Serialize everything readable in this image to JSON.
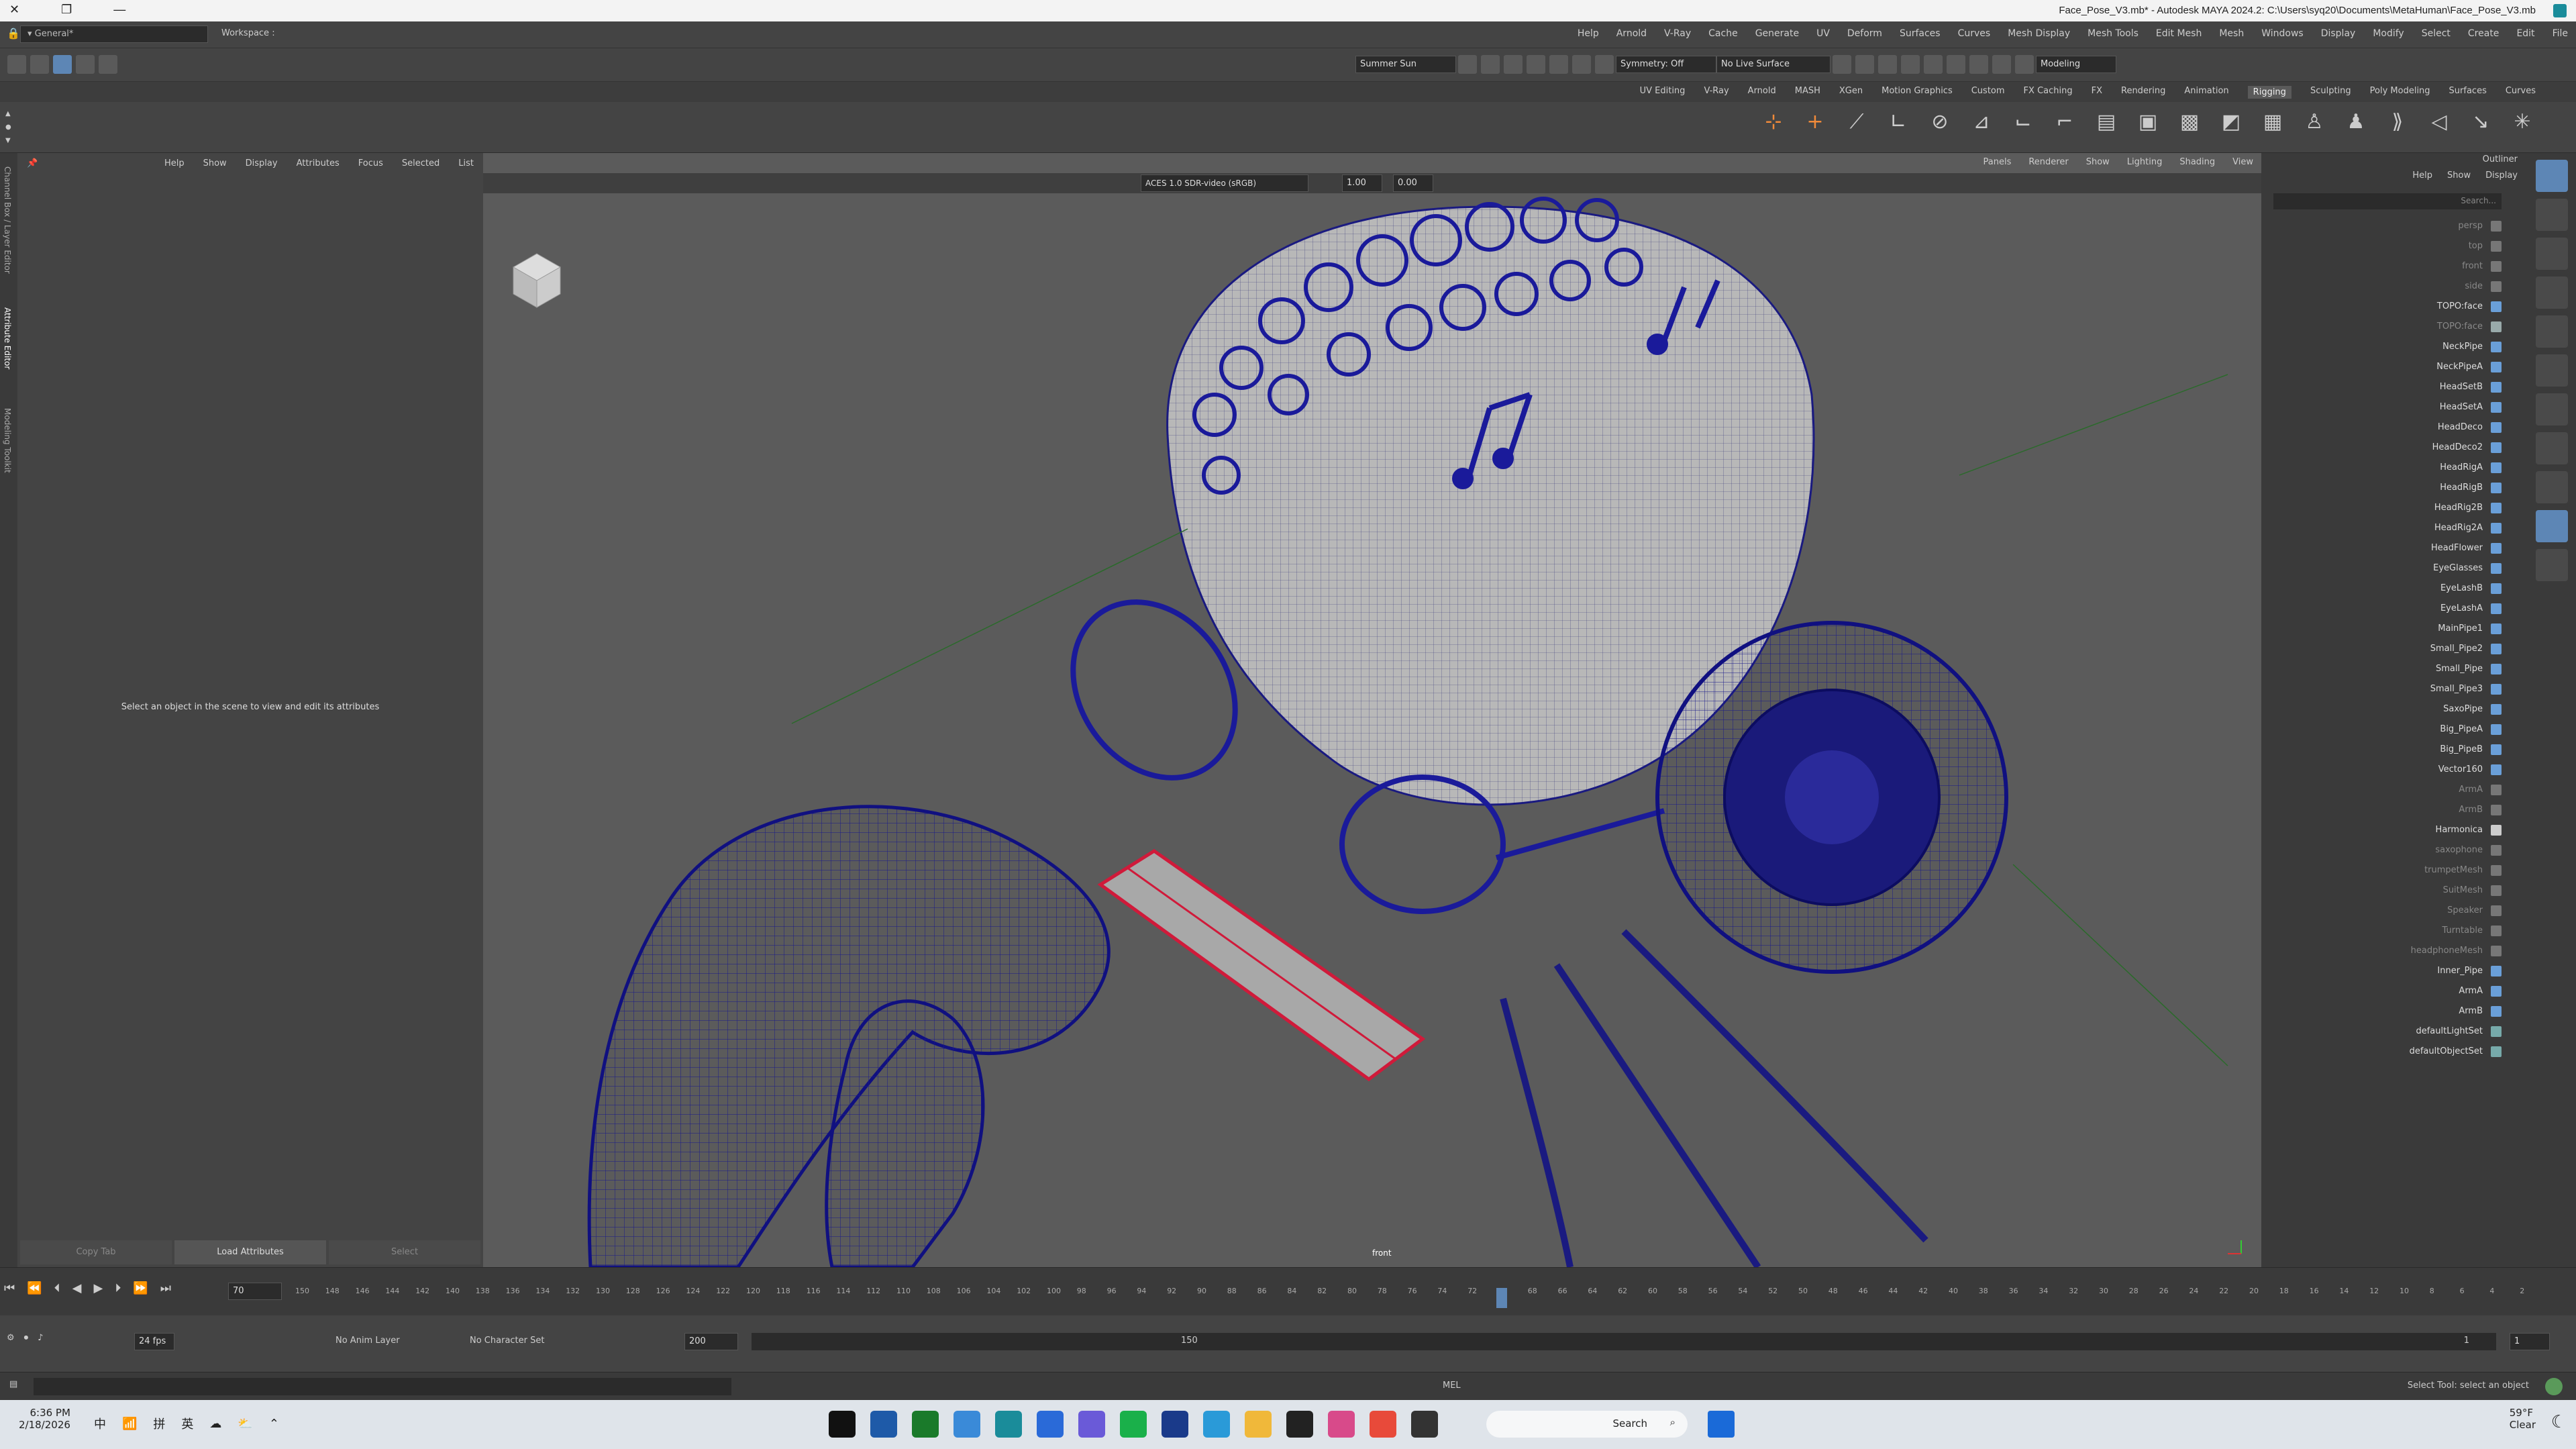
{
  "titlebar": {
    "title": "Face_Pose_V3.mb* - Autodesk MAYA 2024.2: C:\\Users\\syq20\\Documents\\MetaHuman\\Face_Pose_V3.mb",
    "app_icon": "maya-icon"
  },
  "menubar": {
    "workspace_label": "Workspace :",
    "workspace_value": "General*",
    "menus": [
      "File",
      "Edit",
      "Create",
      "Select",
      "Modify",
      "Display",
      "Windows",
      "Mesh",
      "Edit Mesh",
      "Mesh Tools",
      "Mesh Display",
      "Curves",
      "Surfaces",
      "Deform",
      "UV",
      "Generate",
      "Cache",
      "V-Ray",
      "Arnold",
      "Help"
    ]
  },
  "statusline": {
    "mode": "Modeling",
    "symmetry": "Symmetry: Off",
    "live": "No Live Surface",
    "sun": "Summer Sun"
  },
  "shelf": {
    "tabs": [
      "Curves",
      "Surfaces",
      "Poly Modeling",
      "Sculpting",
      "Rigging",
      "Animation",
      "Rendering",
      "FX",
      "FX Caching",
      "Custom",
      "Motion Graphics",
      "XGen",
      "MASH",
      "Arnold",
      "V-Ray"
    ],
    "active_tab": "Rigging",
    "uv_editing": "UV Editing"
  },
  "left_strip": {
    "tabs": [
      "Channel Box / Layer Editor",
      "Attribute Editor",
      "Modeling Toolkit"
    ]
  },
  "attribute_editor": {
    "menus": [
      "List",
      "Selected",
      "Focus",
      "Attributes",
      "Display",
      "Show",
      "Help"
    ],
    "message": "Select an object in the scene to view and edit its attributes",
    "buttons": {
      "select": "Select",
      "load": "Load Attributes",
      "copy": "Copy Tab"
    }
  },
  "viewport": {
    "menus": [
      "View",
      "Shading",
      "Lighting",
      "Show",
      "Renderer",
      "Panels"
    ],
    "exposure": "0.00",
    "gamma": "1.00",
    "colorspace": "ACES 1.0 SDR-video (sRGB)",
    "camera": "front"
  },
  "outliner": {
    "title": "Outliner",
    "menus": [
      "Display",
      "Show",
      "Help"
    ],
    "search_placeholder": "Search...",
    "items": [
      {
        "label": "persp",
        "dim": true,
        "color": "#777"
      },
      {
        "label": "top",
        "dim": true,
        "color": "#777"
      },
      {
        "label": "front",
        "dim": true,
        "color": "#777"
      },
      {
        "label": "side",
        "dim": true,
        "color": "#777"
      },
      {
        "label": "TOPO:face",
        "dim": false,
        "color": "#6a9fd8"
      },
      {
        "label": "TOPO:face",
        "dim": true,
        "color": "#9aa"
      },
      {
        "label": "NeckPipe",
        "dim": false,
        "color": "#6a9fd8"
      },
      {
        "label": "NeckPipeA",
        "dim": false,
        "color": "#6a9fd8"
      },
      {
        "label": "HeadSetB",
        "dim": false,
        "color": "#6a9fd8"
      },
      {
        "label": "HeadSetA",
        "dim": false,
        "color": "#6a9fd8"
      },
      {
        "label": "HeadDeco",
        "dim": false,
        "color": "#6a9fd8"
      },
      {
        "label": "HeadDeco2",
        "dim": false,
        "color": "#6a9fd8"
      },
      {
        "label": "HeadRigA",
        "dim": false,
        "color": "#6a9fd8"
      },
      {
        "label": "HeadRigB",
        "dim": false,
        "color": "#6a9fd8"
      },
      {
        "label": "HeadRig2B",
        "dim": false,
        "color": "#6a9fd8"
      },
      {
        "label": "HeadRig2A",
        "dim": false,
        "color": "#6a9fd8"
      },
      {
        "label": "HeadFlower",
        "dim": false,
        "color": "#6a9fd8"
      },
      {
        "label": "EyeGlasses",
        "dim": false,
        "color": "#6a9fd8"
      },
      {
        "label": "EyeLashB",
        "dim": false,
        "color": "#6a9fd8"
      },
      {
        "label": "EyeLashA",
        "dim": false,
        "color": "#6a9fd8"
      },
      {
        "label": "MainPipe1",
        "dim": false,
        "color": "#6a9fd8"
      },
      {
        "label": "Small_Pipe2",
        "dim": false,
        "color": "#6a9fd8"
      },
      {
        "label": "Small_Pipe",
        "dim": false,
        "color": "#6a9fd8"
      },
      {
        "label": "Small_Pipe3",
        "dim": false,
        "color": "#6a9fd8"
      },
      {
        "label": "SaxoPipe",
        "dim": false,
        "color": "#6a9fd8"
      },
      {
        "label": "Big_PipeA",
        "dim": false,
        "color": "#6a9fd8"
      },
      {
        "label": "Big_PipeB",
        "dim": false,
        "color": "#6a9fd8"
      },
      {
        "label": "Vector160",
        "dim": false,
        "color": "#6a9fd8"
      },
      {
        "label": "ArmA",
        "dim": true,
        "color": "#777"
      },
      {
        "label": "ArmB",
        "dim": true,
        "color": "#777"
      },
      {
        "label": "Harmonica",
        "dim": false,
        "color": "#ccc"
      },
      {
        "label": "saxophone",
        "dim": true,
        "color": "#777"
      },
      {
        "label": "trumpetMesh",
        "dim": true,
        "color": "#777"
      },
      {
        "label": "SuitMesh",
        "dim": true,
        "color": "#777"
      },
      {
        "label": "Speaker",
        "dim": true,
        "color": "#777"
      },
      {
        "label": "Turntable",
        "dim": true,
        "color": "#777"
      },
      {
        "label": "headphoneMesh",
        "dim": true,
        "color": "#777"
      },
      {
        "label": "Inner_Pipe",
        "dim": false,
        "color": "#6a9fd8"
      },
      {
        "label": "ArmA",
        "dim": false,
        "color": "#6a9fd8"
      },
      {
        "label": "ArmB",
        "dim": false,
        "color": "#6a9fd8"
      },
      {
        "label": "defaultLightSet",
        "dim": false,
        "color": "#7aa"
      },
      {
        "label": "defaultObjectSet",
        "dim": false,
        "color": "#7aa"
      }
    ]
  },
  "timeslider": {
    "current_frame": "70",
    "ticks": [
      "2",
      "4",
      "6",
      "8",
      "10",
      "12",
      "14",
      "16",
      "18",
      "20",
      "22",
      "24",
      "26",
      "28",
      "30",
      "32",
      "34",
      "36",
      "38",
      "40",
      "42",
      "44",
      "46",
      "48",
      "50",
      "52",
      "54",
      "56",
      "58",
      "60",
      "62",
      "64",
      "66",
      "68",
      "70",
      "72",
      "74",
      "76",
      "78",
      "80",
      "82",
      "84",
      "86",
      "88",
      "90",
      "92",
      "94",
      "96",
      "98",
      "100",
      "102",
      "104",
      "106",
      "108",
      "110",
      "112",
      "114",
      "116",
      "118",
      "120",
      "122",
      "124",
      "126",
      "128",
      "130",
      "132",
      "134",
      "136",
      "138",
      "140",
      "142",
      "144",
      "146",
      "148",
      "150"
    ]
  },
  "rangebar": {
    "start": "1",
    "range_start": "1",
    "range_end": "150",
    "end": "200",
    "char_set": "No Character Set",
    "anim_layer": "No Anim Layer",
    "fps": "24 fps"
  },
  "cmdline": {
    "lang": "MEL",
    "help": "Select Tool: select an object"
  },
  "taskbar": {
    "search": "Search",
    "time": "6:36 PM",
    "date": "2/18/2026",
    "weather_temp": "59°F",
    "weather_desc": "Clear",
    "lang1": "英",
    "lang2": "拼",
    "lang3": "中"
  }
}
